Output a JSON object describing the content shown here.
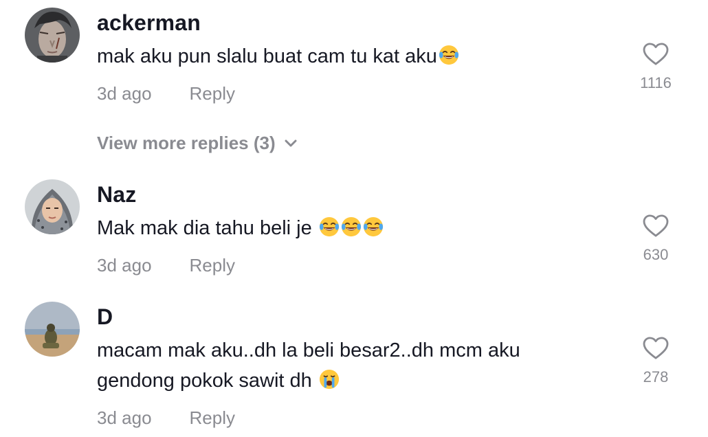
{
  "comments": [
    {
      "username": "ackerman",
      "text": "mak aku pun slalu buat cam tu kat aku",
      "emojis": [
        "joy-emoji"
      ],
      "time": "3d ago",
      "reply_label": "Reply",
      "likes": "1116"
    },
    {
      "username": "Naz",
      "text": "Mak mak dia tahu beli je ",
      "emojis": [
        "joy-emoji",
        "joy-emoji",
        "joy-emoji"
      ],
      "time": "3d ago",
      "reply_label": "Reply",
      "likes": "630"
    },
    {
      "username": "D",
      "text_line1": "macam mak aku..dh la beli besar2..dh mcm aku",
      "text_line2": "gendong pokok sawit dh ",
      "emojis": [
        "sob-emoji"
      ],
      "time": "3d ago",
      "reply_label": "Reply",
      "likes": "278"
    }
  ],
  "view_more": {
    "label": "View more replies (3)",
    "icon": "chevron-down-icon"
  },
  "colors": {
    "text": "#161823",
    "muted": "#8a8b91",
    "background": "#ffffff"
  },
  "icons": {
    "like": "heart-outline-icon"
  }
}
